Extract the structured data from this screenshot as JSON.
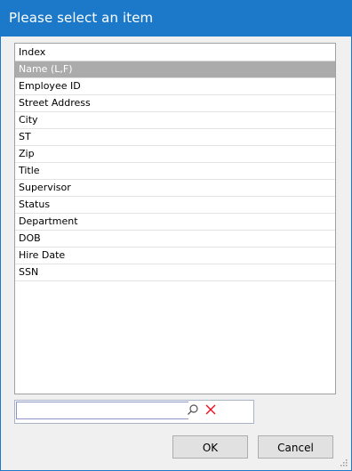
{
  "window": {
    "title": "Please select an item"
  },
  "list": {
    "header": "Index",
    "selected_index": 0,
    "items": [
      "Name (L,F)",
      "Employee ID",
      "Street Address",
      "City",
      "ST",
      "Zip",
      "Title",
      "Supervisor",
      "Status",
      "Department",
      "DOB",
      "Hire Date",
      "SSN"
    ]
  },
  "search": {
    "value": "",
    "search_icon": "search-icon",
    "clear_icon": "clear-icon"
  },
  "buttons": {
    "ok_label": "OK",
    "cancel_label": "Cancel"
  },
  "colors": {
    "titlebar": "#1c79c9",
    "selected_row": "#ababab",
    "clear_icon": "#e81123"
  }
}
